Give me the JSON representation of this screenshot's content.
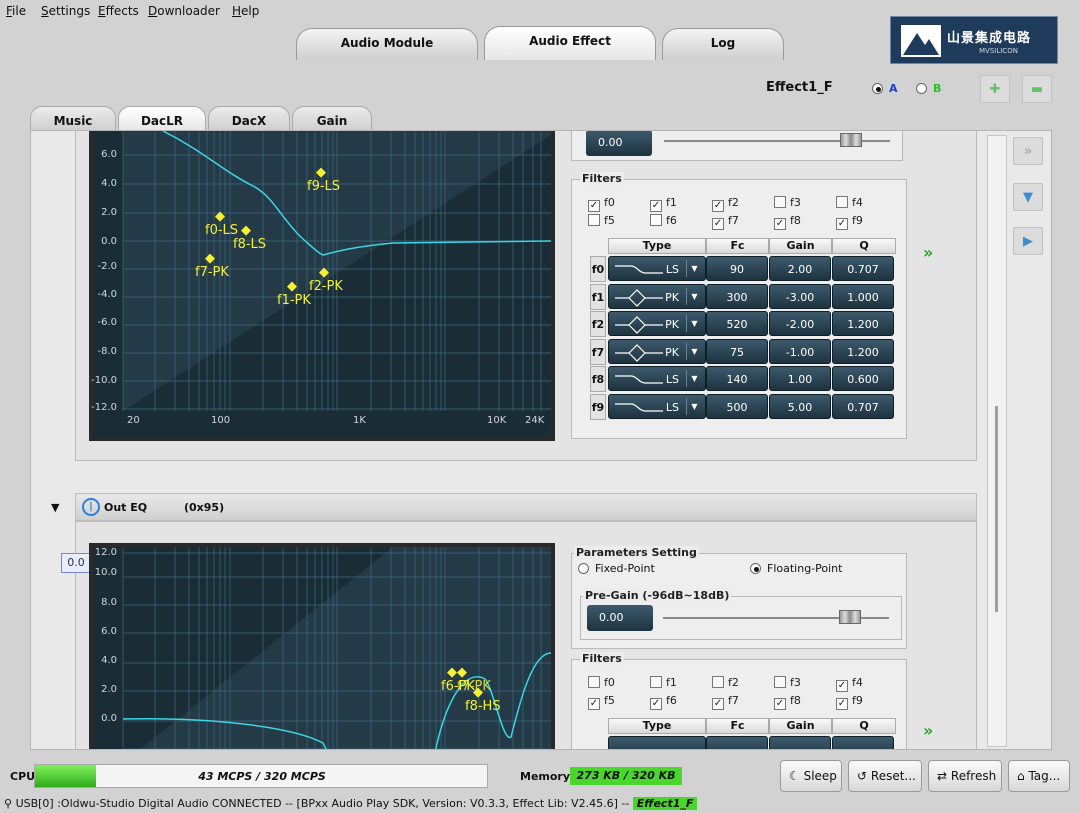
{
  "menu": [
    "File",
    "Settings",
    "Effects",
    "Downloader",
    "Help"
  ],
  "top_tabs": [
    "Audio Module",
    "Audio Effect",
    "Log"
  ],
  "logo": {
    "title": "山景集成电路",
    "subtitle": "MVSILICON"
  },
  "effect_name": "Effect1_F",
  "radio_a": "A",
  "radio_b": "B",
  "sub_tabs": [
    "Music",
    "DacLR",
    "DacX",
    "Gain"
  ],
  "upper_eq": {
    "y_ticks": [
      "6.0",
      "4.0",
      "2.0",
      "0.0",
      "-2.0",
      "-4.0",
      "-6.0",
      "-8.0",
      "-10.0",
      "-12.0"
    ],
    "x_ticks": [
      "20",
      "100",
      "1K",
      "10K",
      "24K"
    ],
    "markers": [
      "f9-LS",
      "f0-LS",
      "f8-LS",
      "f7-PK",
      "f1-PK",
      "f2-PK"
    ],
    "pregain_value": "0.00",
    "filters_label": "Filters",
    "filter_checks": [
      {
        "label": "f0",
        "checked": true
      },
      {
        "label": "f1",
        "checked": true
      },
      {
        "label": "f2",
        "checked": true
      },
      {
        "label": "f3",
        "checked": false
      },
      {
        "label": "f4",
        "checked": false
      },
      {
        "label": "f5",
        "checked": false
      },
      {
        "label": "f6",
        "checked": false
      },
      {
        "label": "f7",
        "checked": true
      },
      {
        "label": "f8",
        "checked": true
      },
      {
        "label": "f9",
        "checked": true
      }
    ],
    "columns": [
      "Type",
      "Fc",
      "Gain",
      "Q"
    ],
    "rows": [
      {
        "id": "f0",
        "type": "LS",
        "fc": "90",
        "gain": "2.00",
        "q": "0.707"
      },
      {
        "id": "f1",
        "type": "PK",
        "fc": "300",
        "gain": "-3.00",
        "q": "1.000"
      },
      {
        "id": "f2",
        "type": "PK",
        "fc": "520",
        "gain": "-2.00",
        "q": "1.200"
      },
      {
        "id": "f7",
        "type": "PK",
        "fc": "75",
        "gain": "-1.00",
        "q": "1.200"
      },
      {
        "id": "f8",
        "type": "LS",
        "fc": "140",
        "gain": "1.00",
        "q": "0.600"
      },
      {
        "id": "f9",
        "type": "LS",
        "fc": "500",
        "gain": "5.00",
        "q": "0.707"
      }
    ]
  },
  "out_eq": {
    "title": "Out EQ",
    "code": "(0x95)",
    "tooltip": "0.0",
    "y_ticks": [
      "12.0",
      "10.0",
      "8.0",
      "6.0",
      "4.0",
      "2.0",
      "0.0"
    ],
    "markers": [
      "f6-PK",
      "f7-PK",
      "f8-HS"
    ],
    "params_label": "Parameters Setting",
    "fixed_point": "Fixed-Point",
    "floating_point": "Floating-Point",
    "pregain_label": "Pre-Gain (-96dB~18dB)",
    "pregain_value": "0.00",
    "filters_label": "Filters",
    "filter_checks": [
      {
        "label": "f0",
        "checked": false
      },
      {
        "label": "f1",
        "checked": false
      },
      {
        "label": "f2",
        "checked": false
      },
      {
        "label": "f3",
        "checked": false
      },
      {
        "label": "f4",
        "checked": true
      },
      {
        "label": "f5",
        "checked": true
      },
      {
        "label": "f6",
        "checked": true
      },
      {
        "label": "f7",
        "checked": true
      },
      {
        "label": "f8",
        "checked": true
      },
      {
        "label": "f9",
        "checked": true
      }
    ],
    "columns": [
      "Type",
      "Fc",
      "Gain",
      "Q"
    ]
  },
  "status": {
    "cpu_label": "CPU",
    "cpu_text": "43 MCPS / 320 MCPS",
    "cpu_fraction": 0.134,
    "mem_label": "Memory",
    "mem_text": "273 KB / 320 KB",
    "sleep": "Sleep",
    "reset": "Reset...",
    "refresh": "Refresh",
    "tag": "Tag...",
    "statusbar": "USB[0] :Oldwu-Studio Digital Audio CONNECTED -- [BPxx Audio Play SDK,  Version: V0.3.3,  Effect Lib: V2.45.6] --",
    "statusbar_effect": "Effect1_F"
  },
  "colors": {
    "accent_green": "#4bd62e",
    "curve": "#3cd6e6",
    "marker": "#f6f030",
    "radio_a": "#1a3cd0",
    "radio_b": "#27c227"
  }
}
